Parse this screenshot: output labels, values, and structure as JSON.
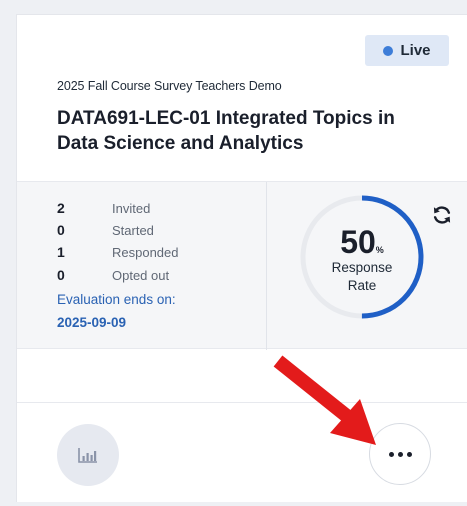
{
  "status": {
    "label": "Live",
    "dot_color": "#3d7dd8"
  },
  "survey": {
    "name": "2025 Fall Course Survey Teachers Demo",
    "course_title": "DATA691-LEC-01 Integrated Topics in Data Science and Analytics"
  },
  "stats": [
    {
      "value": "2",
      "label": "Invited"
    },
    {
      "value": "0",
      "label": "Started"
    },
    {
      "value": "1",
      "label": "Responded"
    },
    {
      "value": "0",
      "label": "Opted out"
    }
  ],
  "evaluation": {
    "label": "Evaluation ends on:",
    "end_date": "2025-09-09"
  },
  "response_rate": {
    "value": "50",
    "unit": "%",
    "caption_line1": "Response",
    "caption_line2": "Rate",
    "fraction": 0.5,
    "color": "#1f5fc6",
    "track_color": "#e8eaee"
  },
  "icons": {
    "refresh": "refresh-icon",
    "report": "bar-chart-icon",
    "more": "more-horizontal-icon"
  },
  "annotation": {
    "arrow_color": "#e31b1b"
  }
}
